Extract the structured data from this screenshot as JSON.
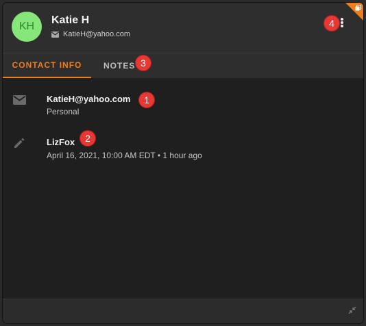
{
  "contact": {
    "initials": "KH",
    "name": "Katie H",
    "email": "KatieH@yahoo.com"
  },
  "tabs": [
    {
      "label": "CONTACT INFO",
      "active": true
    },
    {
      "label": "NOTES",
      "active": false
    }
  ],
  "details": {
    "email_value": "KatieH@yahoo.com",
    "email_type": "Personal",
    "author": "LizFox",
    "timestamp": "April 16, 2021, 10:00 AM EDT • 1 hour ago"
  },
  "badges": [
    "1",
    "2",
    "3",
    "4"
  ],
  "icons": {
    "header_email": "envelope-icon",
    "more": "more-vertical-icon",
    "corner": "copy-icon",
    "email_row": "envelope-icon",
    "note_row": "pencil-icon",
    "footer": "collapse-icon"
  },
  "colors": {
    "accent": "#ef7d1a",
    "avatar_bg": "#86e67a",
    "badge": "#e53935"
  }
}
